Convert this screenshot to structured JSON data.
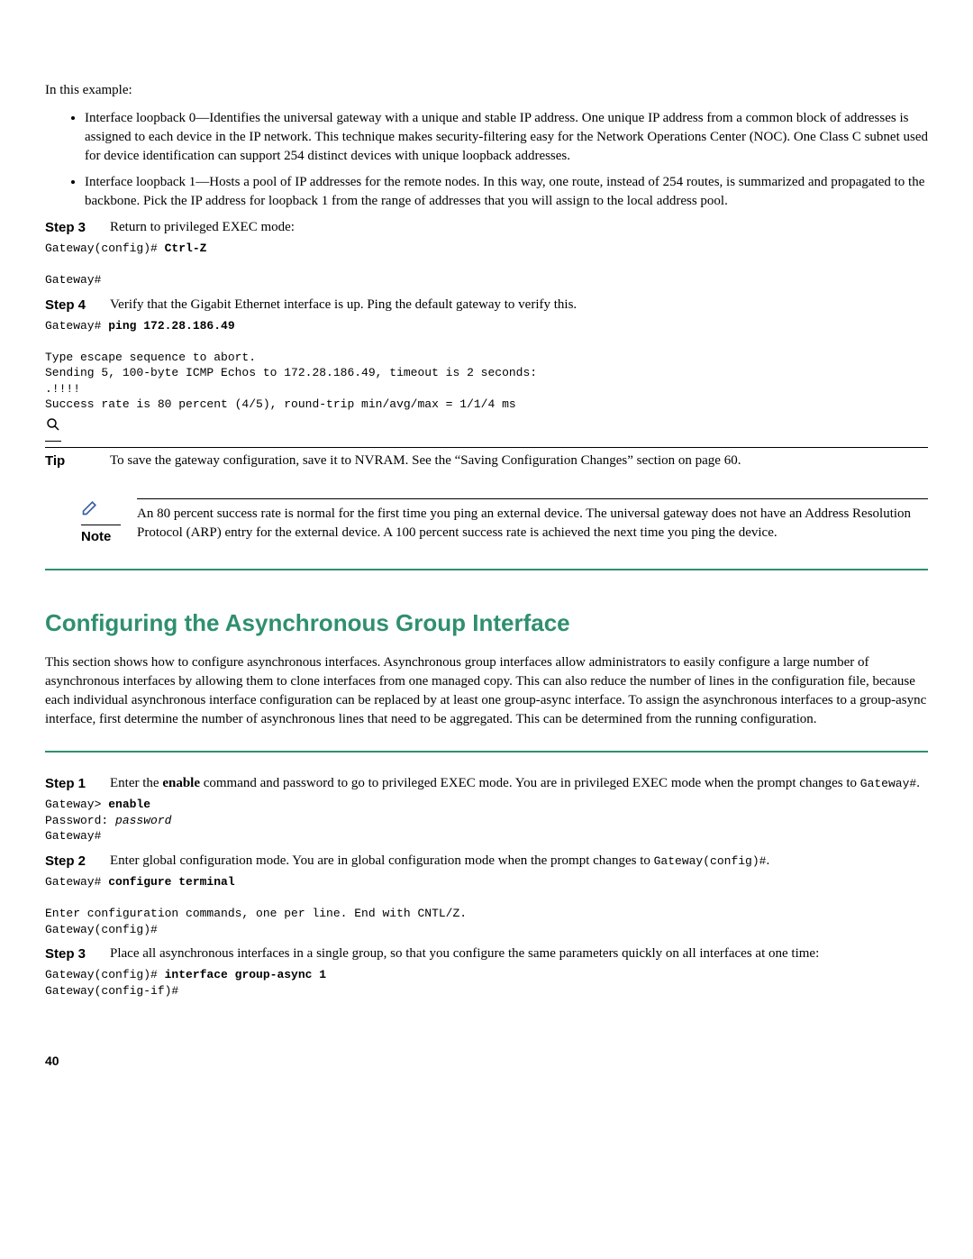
{
  "intro": "In this example:",
  "bullets": [
    "Interface loopback 0—Identifies the universal gateway with a unique and stable IP address. One unique IP address from a common block of addresses is assigned to each device in the IP network. This technique makes security-filtering easy for the Network Operations Center (NOC). One Class C subnet used for device identification can support 254 distinct devices with unique loopback addresses.",
    "Interface loopback 1—Hosts a pool of IP addresses for the remote nodes. In this way, one route, instead of 254 routes, is summarized and propagated to the backbone. Pick the IP address for loopback 1 from the range of addresses that you will assign to the local address pool."
  ],
  "step3": {
    "label": "Step 3",
    "text": "Return to privileged EXEC mode:"
  },
  "code1_prefix": "Gateway(config)# ",
  "code1_bold": "Ctrl-Z",
  "code1_tail": "\n\nGateway#",
  "step4": {
    "label": "Step 4",
    "text": "Verify that the Gigabit Ethernet interface is up. Ping the default gateway to verify this."
  },
  "code2_prefix": "Gateway# ",
  "code2_bold": "ping 172.28.186.49",
  "code2_tail": "\n\nType escape sequence to abort.\nSending 5, 100-byte ICMP Echos to 172.28.186.49, timeout is 2 seconds:\n.!!!!\nSuccess rate is 80 percent (4/5), round-trip min/avg/max = 1/1/4 ms",
  "tip": {
    "label": "Tip",
    "text": "To save the gateway configuration, save it to NVRAM. See the “Saving Configuration Changes” section on page 60."
  },
  "note": {
    "label": "Note",
    "text": "An 80 percent success rate is normal for the first time you ping an external device. The universal gateway does not have an Address Resolution Protocol (ARP) entry for the external device. A 100 percent success rate is achieved the next time you ping the device."
  },
  "heading": "Configuring the Asynchronous Group Interface",
  "section_intro": "This section shows how to configure asynchronous interfaces. Asynchronous group interfaces allow administrators to easily configure a large number of asynchronous interfaces by allowing them to clone interfaces from one managed copy. This can also reduce the number of lines in the configuration file, because each individual asynchronous interface configuration can be replaced by at least one group-async interface. To assign the asynchronous interfaces to a group-async interface, first determine the number of asynchronous lines that need to be aggregated. This can be determined from the running configuration.",
  "b_step1": {
    "label": "Step 1",
    "pre": "Enter the ",
    "bold": "enable",
    "post": " command and password to go to privileged EXEC mode. You are in privileged EXEC mode when the prompt changes to ",
    "inline_mono": "Gateway#",
    "period": "."
  },
  "code3_prefix": "Gateway> ",
  "code3_bold": "enable",
  "code3_l2a": "Password: ",
  "code3_l2b": "password",
  "code3_l3": "Gateway#",
  "b_step2": {
    "label": "Step 2",
    "pre": "Enter global configuration mode. You are in global configuration mode when the prompt changes to ",
    "inline_mono": "Gateway(config)#",
    "period": "."
  },
  "code4_prefix": "Gateway# ",
  "code4_bold": "configure terminal",
  "code4_tail": "\n\nEnter configuration commands, one per line. End with CNTL/Z.\nGateway(config)#",
  "b_step3": {
    "label": "Step 3",
    "text": "Place all asynchronous interfaces in a single group, so that you configure the same parameters quickly on all interfaces at one time:"
  },
  "code5_prefix": "Gateway(config)# ",
  "code5_bold": "interface group-async 1",
  "code5_tail": "\nGateway(config-if)#",
  "page_num": "40"
}
